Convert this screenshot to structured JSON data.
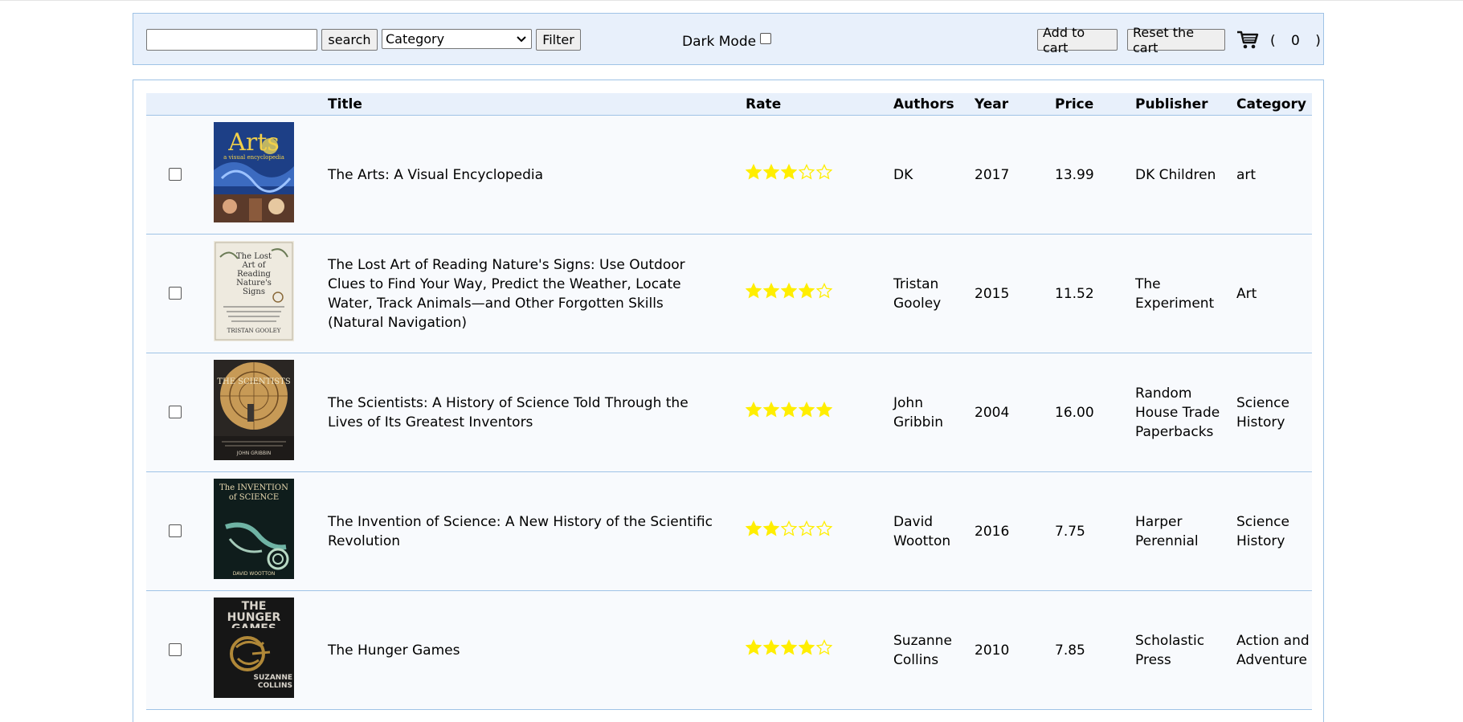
{
  "toolbar": {
    "search_placeholder": "",
    "search_label": "search",
    "category_selected": "Category",
    "filter_label": "Filter",
    "dark_mode_label": "Dark Mode",
    "add_to_cart_label": "Add to cart",
    "reset_cart_label": "Reset the cart",
    "cart_icon": "shopping-cart-icon",
    "cart_open": "(",
    "cart_count": "0",
    "cart_close": ")"
  },
  "table": {
    "headers": {
      "title": "Title",
      "rate": "Rate",
      "authors": "Authors",
      "year": "Year",
      "price": "Price",
      "publisher": "Publisher",
      "category": "Category"
    },
    "rows": [
      {
        "title": "The Arts: A Visual Encyclopedia",
        "rating": 3,
        "authors": "DK",
        "year": "2017",
        "price": "13.99",
        "publisher": "DK Children",
        "category": "art",
        "cover_text": "Arts",
        "cover_sub": "a visual encyclopedia"
      },
      {
        "title": "The Lost Art of Reading Nature's Signs: Use Outdoor Clues to Find Your Way, Predict the Weather, Locate Water, Track Animals—and Other Forgotten Skills (Natural Navigation)",
        "rating": 4,
        "authors": "Tristan Gooley",
        "year": "2015",
        "price": "11.52",
        "publisher": "The Experiment",
        "category": "Art",
        "cover_text": "The Lost Art of Reading Nature's Signs",
        "cover_sub": "TRISTAN GOOLEY"
      },
      {
        "title": "The Scientists: A History of Science Told Through the Lives of Its Greatest Inventors",
        "rating": 5,
        "authors": "John Gribbin",
        "year": "2004",
        "price": "16.00",
        "publisher": "Random House Trade Paperbacks",
        "category": "Science History",
        "cover_text": "THE SCIENTISTS",
        "cover_sub": "JOHN GRIBBIN"
      },
      {
        "title": "The Invention of Science: A New History of the Scientific Revolution",
        "rating": 2,
        "authors": "David Wootton",
        "year": "2016",
        "price": "7.75",
        "publisher": "Harper Perennial",
        "category": "Science History",
        "cover_text": "The INVENTION of SCIENCE",
        "cover_sub": "DAVID WOOTTON"
      },
      {
        "title": "The Hunger Games",
        "rating": 4,
        "authors": "Suzanne Collins",
        "year": "2010",
        "price": "7.85",
        "publisher": "Scholastic Press",
        "category": "Action and Adventure",
        "cover_text": "THE HUNGER GAMES",
        "cover_sub": "SUZANNE COLLINS"
      }
    ]
  },
  "colors": {
    "panel_bg": "#e8f0fb",
    "panel_border": "#9fc3e6",
    "row_bg": "#f8fafd",
    "star": "#ffee00"
  }
}
